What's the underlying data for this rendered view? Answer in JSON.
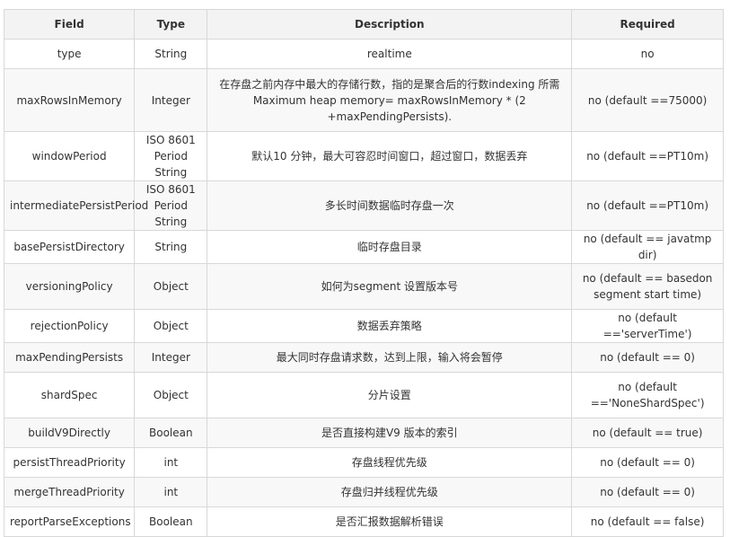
{
  "headers": [
    "Field",
    "Type",
    "Description",
    "Required"
  ],
  "rows": [
    {
      "field": "type",
      "type": "String",
      "description": "realtime",
      "required": "no"
    },
    {
      "field": "maxRowsInMemory",
      "type": "Integer",
      "description": "在存盘之前内存中最大的存储行数，指的是聚合后的行数indexing 所需 Maximum heap memory= maxRowsInMemory * (2 +maxPendingPersists).",
      "required": "no (default ==75000)"
    },
    {
      "field": "windowPeriod",
      "type": "ISO 8601 Period String",
      "description": "默认10 分钟，最大可容忍时间窗口，超过窗口，数据丢弃",
      "required": "no (default ==PT10m)"
    },
    {
      "field": "intermediatePersistPeriod",
      "type": "ISO 8601 Period String",
      "description": "多长时间数据临时存盘一次",
      "required": "no (default ==PT10m)"
    },
    {
      "field": "basePersistDirectory",
      "type": "String",
      "description": "临时存盘目录",
      "required": "no (default == javatmp dir)"
    },
    {
      "field": "versioningPolicy",
      "type": "Object",
      "description": "如何为segment 设置版本号",
      "required": "no (default == basedon segment start time)"
    },
    {
      "field": "rejectionPolicy",
      "type": "Object",
      "description": "数据丢弃策略",
      "required": "no (default =='serverTime')"
    },
    {
      "field": "maxPendingPersists",
      "type": "Integer",
      "description": "最大同时存盘请求数，达到上限，输入将会暂停",
      "required": "no (default == 0)"
    },
    {
      "field": "shardSpec",
      "type": "Object",
      "description": "分片设置",
      "required": "no (default =='NoneShardSpec')"
    },
    {
      "field": "buildV9Directly",
      "type": "Boolean",
      "description": "是否直接构建V9 版本的索引",
      "required": "no (default == true)"
    },
    {
      "field": "persistThreadPriority",
      "type": "int",
      "description": "存盘线程优先级",
      "required": "no (default == 0)"
    },
    {
      "field": "mergeThreadPriority",
      "type": "int",
      "description": "存盘归并线程优先级",
      "required": "no (default == 0)"
    },
    {
      "field": "reportParseExceptions",
      "type": "Boolean",
      "description": "是否汇报数据解析错误",
      "required": "no (default == false)"
    }
  ]
}
